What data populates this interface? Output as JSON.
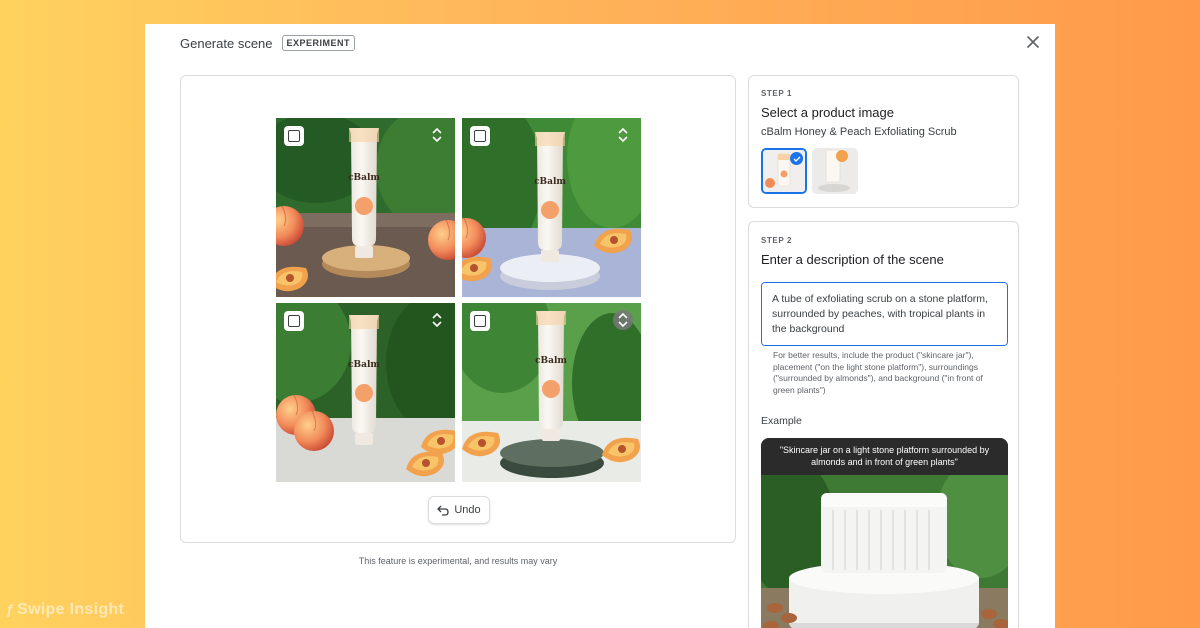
{
  "dialog": {
    "title": "Generate scene",
    "badge": "EXPERIMENT"
  },
  "left_panel": {
    "undo_label": "Undo",
    "footnote": "This feature is experimental, and results may vary"
  },
  "step1": {
    "step_label": "STEP 1",
    "title": "Select a product image",
    "product_name": "cBalm Honey & Peach Exfoliating Scrub"
  },
  "step2": {
    "step_label": "STEP 2",
    "title": "Enter a description of the scene",
    "description_value": "A tube of exfoliating scrub on a stone platform, surrounded by peaches, with tropical plants in the background",
    "hint": "For better results, include the product (\"skincare jar\"), placement (\"on the light stone platform\"), surroundings (\"surrounded by almonds\"), and background (\"in front of green plants\")",
    "example_label": "Example",
    "example_caption": "\"Skincare jar on a light stone platform surrounded by almonds and in front of green plants\""
  },
  "product": {
    "brand": "cBalm"
  },
  "watermark": "Swipe Insight",
  "icons": {
    "close": "close-icon",
    "checkbox": "checkbox-icon",
    "expand": "unfold-icon",
    "undo": "undo-icon",
    "selected": "check-circle-icon"
  },
  "colors": {
    "accent": "#1a73e8",
    "bg_gradient_start": "#ffd25e",
    "bg_gradient_end": "#ff9a4a"
  }
}
